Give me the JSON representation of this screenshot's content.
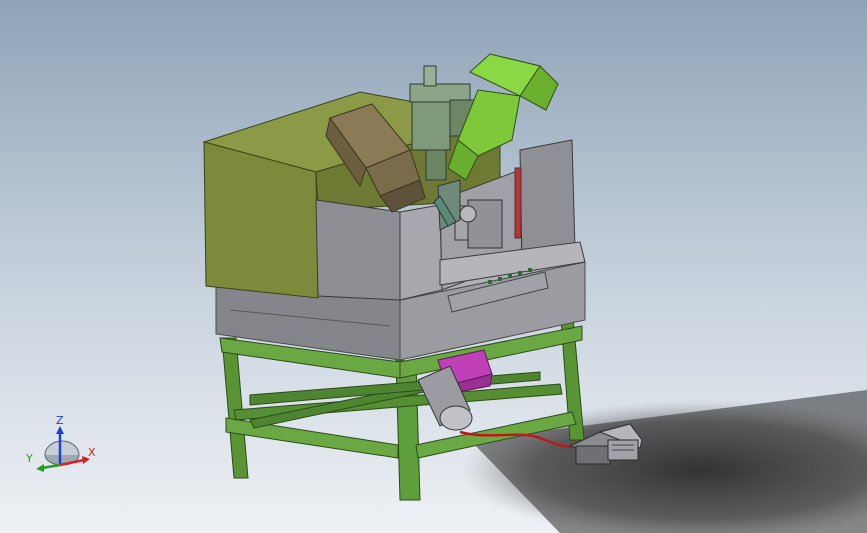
{
  "viewport": {
    "background_top": "#8fa3b8",
    "background_bottom": "#eef1f5"
  },
  "triad": {
    "z_label": "Z",
    "x_label": "X",
    "y_label": "Y",
    "z_color": "#1f3fd6",
    "x_color": "#d22222",
    "y_color": "#22a022"
  },
  "colors": {
    "frame_green": "#5f9e3c",
    "cabinet_olive": "#7d8a3c",
    "steel_gray": "#8c8e94",
    "motor_tan": "#8a7a55",
    "motor_green": "#7fc83a",
    "motor_gray_green": "#7e9a78",
    "accent_magenta": "#c040b8",
    "cable_red": "#c01818"
  }
}
